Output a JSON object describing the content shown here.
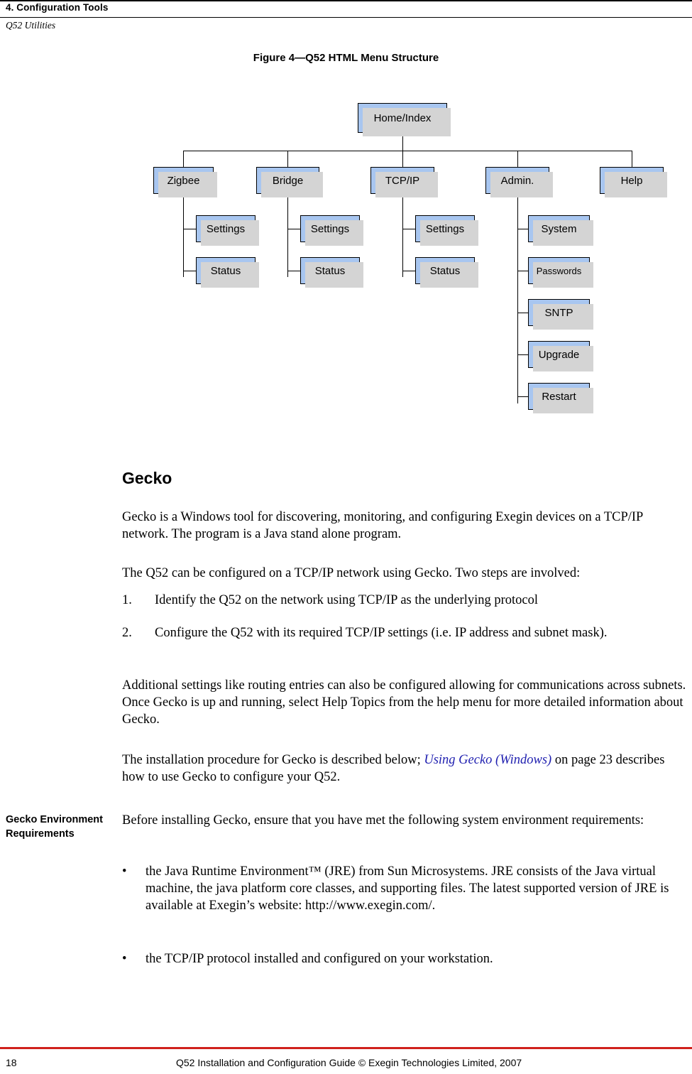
{
  "header": {
    "chapter": "4. Configuration Tools",
    "subtitle": "Q52 Utilities"
  },
  "figure": {
    "title": "Figure 4—Q52 HTML Menu Structure",
    "nodes": {
      "home": "Home/Index",
      "zigbee": "Zigbee",
      "bridge": "Bridge",
      "tcpip": "TCP/IP",
      "admin": "Admin.",
      "help": "Help",
      "zigbee_settings": "Settings",
      "zigbee_status": "Status",
      "bridge_settings": "Settings",
      "bridge_status": "Status",
      "tcpip_settings": "Settings",
      "tcpip_status": "Status",
      "admin_system": "System",
      "admin_passwords": "Passwords",
      "admin_sntp": "SNTP",
      "admin_upgrade": "Upgrade",
      "admin_restart": "Restart"
    }
  },
  "body": {
    "gecko_heading": "Gecko",
    "p1": "Gecko is a Windows tool for discovering, monitoring, and configuring Exegin devices on a TCP/IP network. The program is a Java stand alone program.",
    "p2": "The Q52 can be configured on a TCP/IP network using Gecko. Two steps are involved:",
    "item1_num": "1.",
    "item1_text": "Identify the Q52 on the network using TCP/IP as the underlying protocol",
    "item2_num": "2.",
    "item2_text": "Configure the Q52 with its required TCP/IP settings (i.e. IP address and subnet mask).",
    "p3": "Additional settings like routing entries can also be configured allowing for communications across subnets. Once Gecko is up and running, select Help Topics from the help menu for more detailed information about Gecko.",
    "p4_before": "The installation procedure for Gecko is described below; ",
    "p4_link": "Using Gecko (Windows)",
    "p4_after": " on page 23 describes how to use Gecko to configure your Q52.",
    "sidehead": "Gecko Environment Requirements",
    "p5": "Before installing Gecko, ensure that you have met the following system environment requirements:",
    "bullet1_dot": "•",
    "bullet1_before": "the Java Runtime Environment™ (JRE) from Sun Microsystems. JRE consists of the Java virtual machine, the java platform core classes, and supporting files. The latest supported version of JRE is available at Exegin’s website: ",
    "bullet1_url": "http://www.exegin.com/.",
    "bullet2_dot": "•",
    "bullet2_text": "the TCP/IP protocol installed and configured on your workstation."
  },
  "footer": {
    "page_number": "18",
    "text": "Q52 Installation and Configuration Guide  © Exegin Technologies Limited, 2007"
  }
}
